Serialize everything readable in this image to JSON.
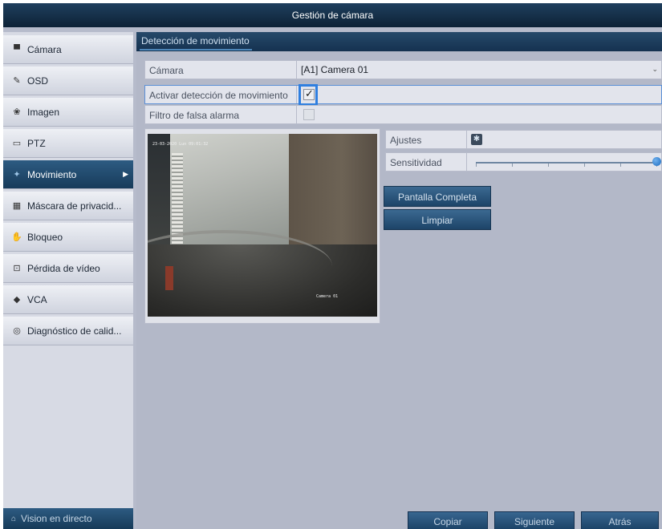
{
  "window": {
    "title": "Gestión de cámara"
  },
  "sidebar": {
    "items": [
      {
        "label": "Cámara",
        "icon": "camera-icon"
      },
      {
        "label": "OSD",
        "icon": "osd-icon"
      },
      {
        "label": "Imagen",
        "icon": "image-icon"
      },
      {
        "label": "PTZ",
        "icon": "ptz-icon"
      },
      {
        "label": "Movimiento",
        "icon": "motion-icon",
        "active": true
      },
      {
        "label": "Máscara de privacid...",
        "icon": "privacy-mask-icon"
      },
      {
        "label": "Bloqueo",
        "icon": "tamper-icon"
      },
      {
        "label": "Pérdida de vídeo",
        "icon": "video-loss-icon"
      },
      {
        "label": "VCA",
        "icon": "vca-icon"
      },
      {
        "label": "Diagnóstico de calid...",
        "icon": "diagnostic-icon"
      }
    ],
    "live_view_label": "Vision en directo"
  },
  "main": {
    "tab_label": "Detección de movimiento",
    "camera_label": "Cámara",
    "camera_value": "[A1] Camera 01",
    "enable_label": "Activar detección de movimiento",
    "enable_checked": true,
    "false_alarm_label": "Filtro de falsa alarma",
    "false_alarm_checked": false,
    "settings_label": "Ajustes",
    "sensitivity_label": "Sensitividad",
    "sensitivity_level": 1.0,
    "fullscreen_label": "Pantalla Completa",
    "clear_label": "Limpiar",
    "video": {
      "osd_timestamp": "23-03-2020 Lun 09:01:32",
      "osd_camera": "Camera 01"
    }
  },
  "footer": {
    "copy_label": "Copiar",
    "next_label": "Siguiente",
    "back_label": "Atrás"
  },
  "colors": {
    "accent": "#2f7fe0",
    "titlebar": "#0d2236",
    "active_item": "#1f4a6e",
    "panel_bg": "#b3b8c8"
  }
}
